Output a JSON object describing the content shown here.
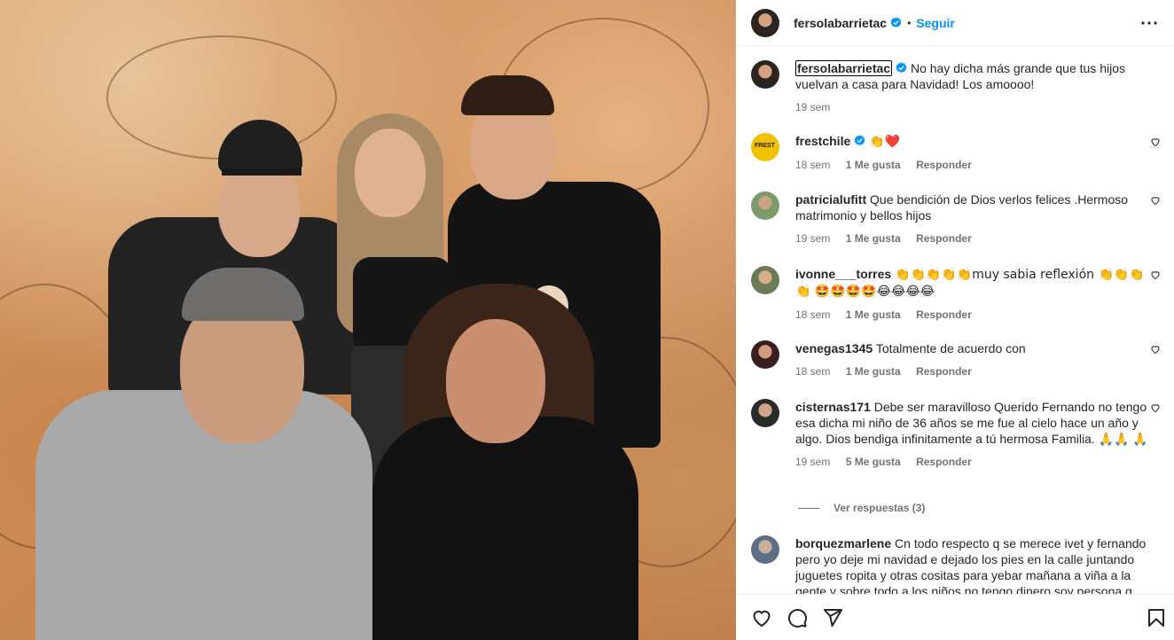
{
  "post": {
    "author": "fersolabarrietac",
    "follow_label": "Seguir",
    "separator": "•"
  },
  "caption": {
    "username": "fersolabarrietac",
    "text": "No hay dicha más grande que tus hijos vuelvan a casa para Navidad! Los amoooo!",
    "time": "19 sem"
  },
  "comments": [
    {
      "username": "frestchile",
      "verified": true,
      "text": "👏❤️",
      "time": "18 sem",
      "likes": "1 Me gusta",
      "reply": "Responder"
    },
    {
      "username": "patricialufitt",
      "text": "Que bendición de Dios verlos felices .Hermoso matrimonio y bellos hijos",
      "time": "19 sem",
      "likes": "1 Me gusta",
      "reply": "Responder"
    },
    {
      "username": "ivonne___torres",
      "text": "👏👏👏👏👏muy sabia reflexión 👏👏👏👏 🤩🤩🤩🤩😂😂😂😂",
      "time": "18 sem",
      "likes": "1 Me gusta",
      "reply": "Responder"
    },
    {
      "username": "venegas1345",
      "text": "Totalmente de acuerdo con",
      "time": "18 sem",
      "likes": "1 Me gusta",
      "reply": "Responder"
    },
    {
      "username": "cisternas171",
      "text": "Debe ser maravilloso Querido Fernando no tengo esa dicha mi niño de 36 años se me fue al cielo hace un año y algo. Dios bendiga infinitamente a tú hermosa Familia. 🙏🙏 🙏",
      "time": "19 sem",
      "likes": "5 Me gusta",
      "reply": "Responder"
    },
    {
      "username": "borquezmarlene",
      "text": "Cn todo respecto q se merece ivet y fernando pero yo deje mi navidad e dejado los pies en la calle juntando juguetes ropita y otras cositas para yebar mañana a viña a la gente y sobre todo a los niños no tengo dinero soy persona q"
    }
  ],
  "view_replies": "Ver respuestas (3)",
  "icons": {
    "like": "heart-icon",
    "comment": "comment-icon",
    "share": "share-icon",
    "save": "bookmark-icon",
    "more": "more-options-icon"
  },
  "colors": {
    "accent": "#0095f6",
    "verified": "#0095f6",
    "muted": "#737373"
  }
}
